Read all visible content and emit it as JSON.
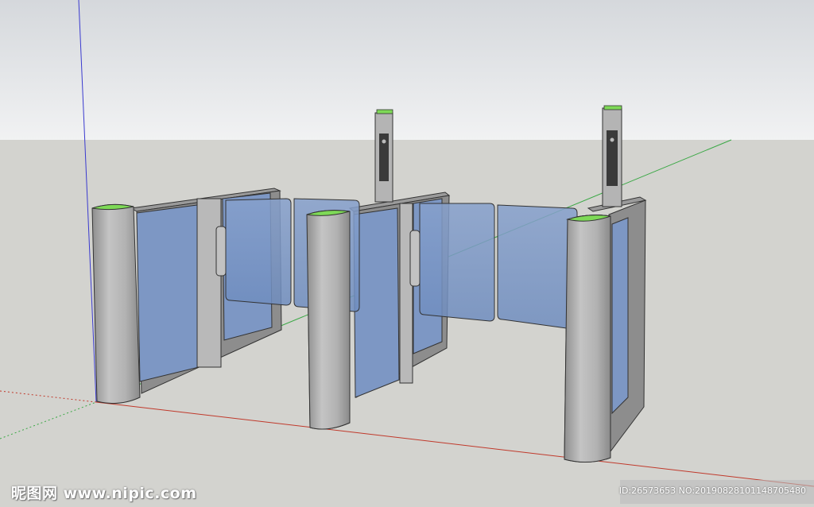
{
  "watermark": {
    "site": "昵图网 www.nipic.com",
    "id_line": "ID:26573653 NO:20190828101148705480"
  },
  "colors": {
    "sky_top": "#d5d8dc",
    "sky_bottom": "#f0f1f2",
    "ground": "#d3d3cf",
    "glass": "#7d9ac8",
    "metal": "#b0b0b0",
    "cap_green": "#7ed957",
    "axis_red": "#c0392b",
    "axis_green": "#3aa845",
    "axis_blue": "#3a3acf"
  }
}
